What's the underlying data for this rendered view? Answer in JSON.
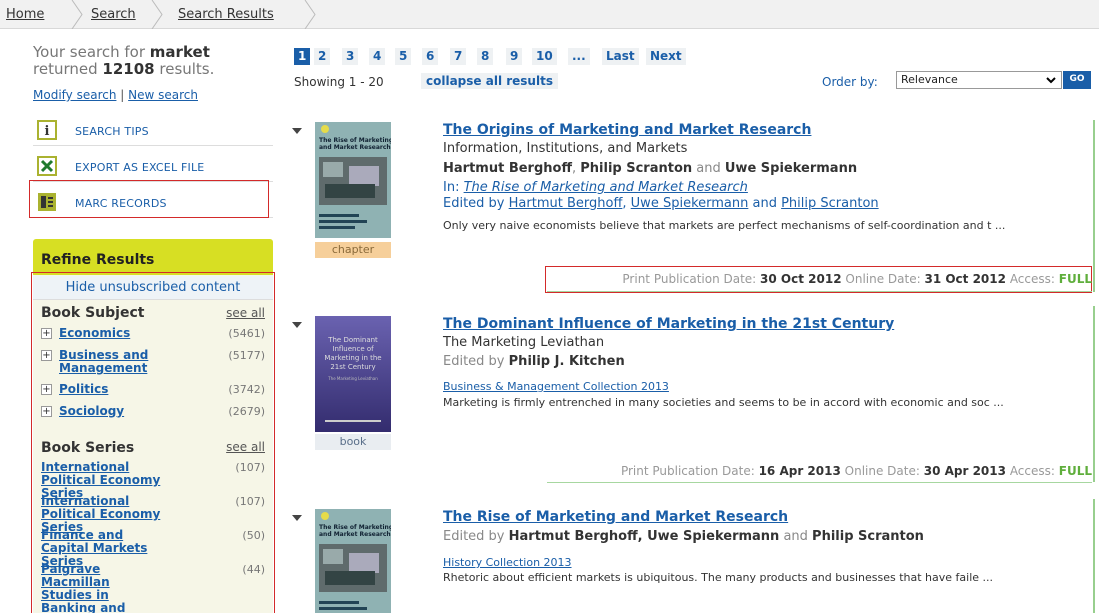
{
  "breadcrumb": [
    "Home",
    "Search",
    "Search Results"
  ],
  "summary": {
    "line1_prefix": "Your search for",
    "query": "market",
    "line2_prefix": "returned",
    "count": "12108",
    "line2_suffix": "results.",
    "modify": "Modify search",
    "separator": "|",
    "new": "New search"
  },
  "tools": [
    {
      "label": "SEARCH TIPS",
      "icon": "info-icon"
    },
    {
      "label": "EXPORT AS EXCEL FILE",
      "icon": "excel-icon"
    },
    {
      "label": "MARC RECORDS",
      "icon": "marc-icon"
    }
  ],
  "refine": {
    "title": "Refine Results",
    "hide_link": "Hide unsubscribed content",
    "subject_title": "Book Subject",
    "subject_see_all": "see all",
    "subjects": [
      {
        "name": "Economics",
        "count": "(5461)"
      },
      {
        "name": "Business and Management",
        "count": "(5177)"
      },
      {
        "name": "Politics",
        "count": "(3742)"
      },
      {
        "name": "Sociology",
        "count": "(2679)"
      }
    ],
    "series_title": "Book Series",
    "series_see_all": "see all",
    "series": [
      {
        "name": "International Political Economy Series",
        "count": "(107)"
      },
      {
        "name": "International Political Economy Series",
        "count": "(107)"
      },
      {
        "name": "Finance and Capital Markets Series",
        "count": "(50)"
      },
      {
        "name": "Palgrave Macmillan Studies in Banking and Financial Institutions",
        "count": "(44)"
      }
    ]
  },
  "pagination": {
    "pages": [
      "1",
      "2",
      "3",
      "4",
      "5",
      "6",
      "7",
      "8",
      "9",
      "10",
      "...",
      "Last",
      "Next"
    ],
    "active": "1"
  },
  "showing": "Showing 1 - 20",
  "collapse_all": "collapse all results",
  "order": {
    "label": "Order by:",
    "value": "Relevance",
    "go": "GO"
  },
  "results": [
    {
      "title": "The Origins of Marketing and Market Research",
      "subtitle": "Information, Institutions, and Markets",
      "authors_line": [
        "Hartmut Berghoff",
        ", ",
        "Philip Scranton",
        " and ",
        "Uwe Spiekermann"
      ],
      "in_prefix": "In:",
      "in_book": "The Rise of Marketing and Market Research",
      "edited_prefix": "Edited by",
      "editors": [
        "Hartmut Berghoff",
        ", ",
        "Uwe Spiekermann",
        " and ",
        "Philip Scranton"
      ],
      "abstract": "Only very naive economists believe that markets are perfect mechanisms of self-coordination and t ...",
      "type": "chapter",
      "cover_title": "The Rise of Marketing and Market Research",
      "print_label": "Print Publication Date:",
      "print_date": "30 Oct 2012",
      "online_label": "Online Date:",
      "online_date": "31 Oct 2012",
      "access_label": "Access:",
      "access": "FULL"
    },
    {
      "title": "The Dominant Influence of Marketing in the 21st Century",
      "subtitle": "The Marketing Leviathan",
      "edited_prefix": "Edited by",
      "editor": "Philip J. Kitchen",
      "collection": "Business & Management Collection 2013",
      "abstract": "Marketing is firmly entrenched in many societies and seems to be in accord with economic and soc ...",
      "type": "book",
      "cover_title": "The Dominant Influence of Marketing in the 21st Century",
      "cover_subtitle": "The Marketing Leviathan",
      "print_label": "Print Publication Date:",
      "print_date": "16 Apr 2013",
      "online_label": "Online Date:",
      "online_date": "30 Apr 2013",
      "access_label": "Access:",
      "access": "FULL"
    },
    {
      "title": "The Rise of Marketing and Market Research",
      "edited_prefix": "Edited by",
      "editors": [
        "Hartmut Berghoff",
        ", ",
        "Uwe Spiekermann",
        " and ",
        "Philip Scranton"
      ],
      "collection": "History Collection 2013",
      "abstract": "Rhetoric about efficient markets is ubiquitous. The many products and businesses that have faile ...",
      "cover_title": "The Rise of Marketing and Market Research"
    }
  ],
  "colors": {
    "link": "#1a5ea8",
    "refine_header": "#d7df23",
    "access_full": "#5fae3c",
    "highlight_box": "#d32a2a"
  }
}
